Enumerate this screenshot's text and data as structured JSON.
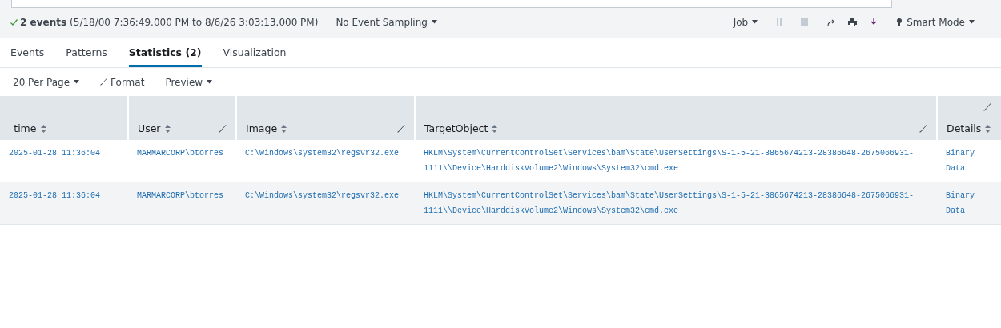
{
  "status_bar": {
    "count": "2 events",
    "range": "(5/18/00 7:36:49.000 PM to 8/6/26 3:03:13.000 PM)",
    "sampling": "No Event Sampling",
    "job": "Job",
    "mode": "Smart Mode"
  },
  "tabs": [
    {
      "label": "Events",
      "selected": false
    },
    {
      "label": "Patterns",
      "selected": false
    },
    {
      "label": "Statistics (2)",
      "selected": true
    },
    {
      "label": "Visualization",
      "selected": false
    }
  ],
  "toolbar": {
    "per_page": "20 Per Page",
    "format": "Format",
    "preview": "Preview"
  },
  "table": {
    "columns": [
      {
        "label": "_time",
        "format_icon": false
      },
      {
        "label": "User",
        "format_icon": true
      },
      {
        "label": "Image",
        "format_icon": true
      },
      {
        "label": "TargetObject",
        "format_icon": true
      },
      {
        "label": "Details",
        "format_icon": true
      }
    ],
    "rows": [
      [
        "2025-01-28 11:36:04",
        "MARMARCORP\\btorres",
        "C:\\Windows\\system32\\regsvr32.exe",
        "HKLM\\System\\CurrentControlSet\\Services\\bam\\State\\UserSettings\\S-1-5-21-3865674213-28386648-2675066931-1111\\\\Device\\HarddiskVolume2\\Windows\\System32\\cmd.exe",
        "Binary Data"
      ],
      [
        "2025-01-28 11:36:04",
        "MARMARCORP\\btorres",
        "C:\\Windows\\system32\\regsvr32.exe",
        "HKLM\\System\\CurrentControlSet\\Services\\bam\\State\\UserSettings\\S-1-5-21-3865674213-28386648-2675066931-1111\\\\Device\\HarddiskVolume2\\Windows\\System32\\cmd.exe",
        "Binary Data"
      ]
    ]
  }
}
